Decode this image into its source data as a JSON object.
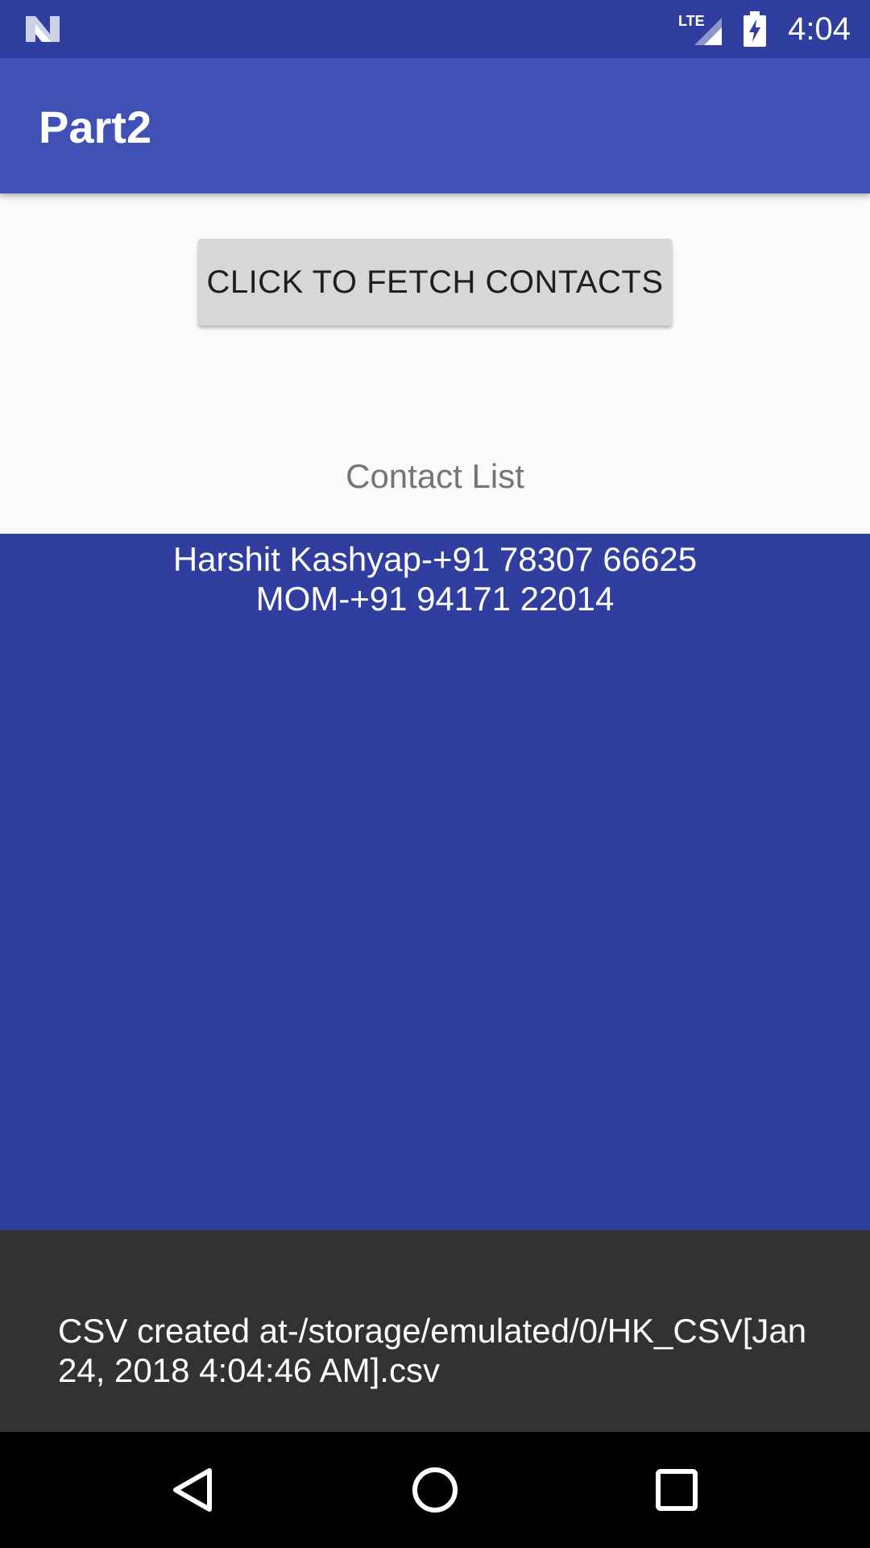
{
  "status_bar": {
    "time": "4:04",
    "network_label": "LTE",
    "icons": [
      "n-logo-icon",
      "lte-signal-icon",
      "battery-charging-icon"
    ]
  },
  "app_bar": {
    "title": "Part2"
  },
  "main": {
    "fetch_button_label": "CLICK TO FETCH CONTACTS",
    "contact_list_label": "Contact List",
    "contacts": [
      "Harshit Kashyap-+91 78307 66625",
      "MOM-+91 94171 22014"
    ]
  },
  "snackbar": {
    "message": "CSV created at-/storage/emulated/0/HK_CSV[Jan 24, 2018 4:04:46 AM].csv"
  },
  "nav_bar": {
    "icons": [
      "back-icon",
      "home-icon",
      "recents-icon"
    ]
  },
  "colors": {
    "status_bar": "#303f9f",
    "app_bar": "#3f51b5",
    "contacts_panel": "#303f9f",
    "snackbar": "#323232",
    "button": "#d6d7d7"
  }
}
